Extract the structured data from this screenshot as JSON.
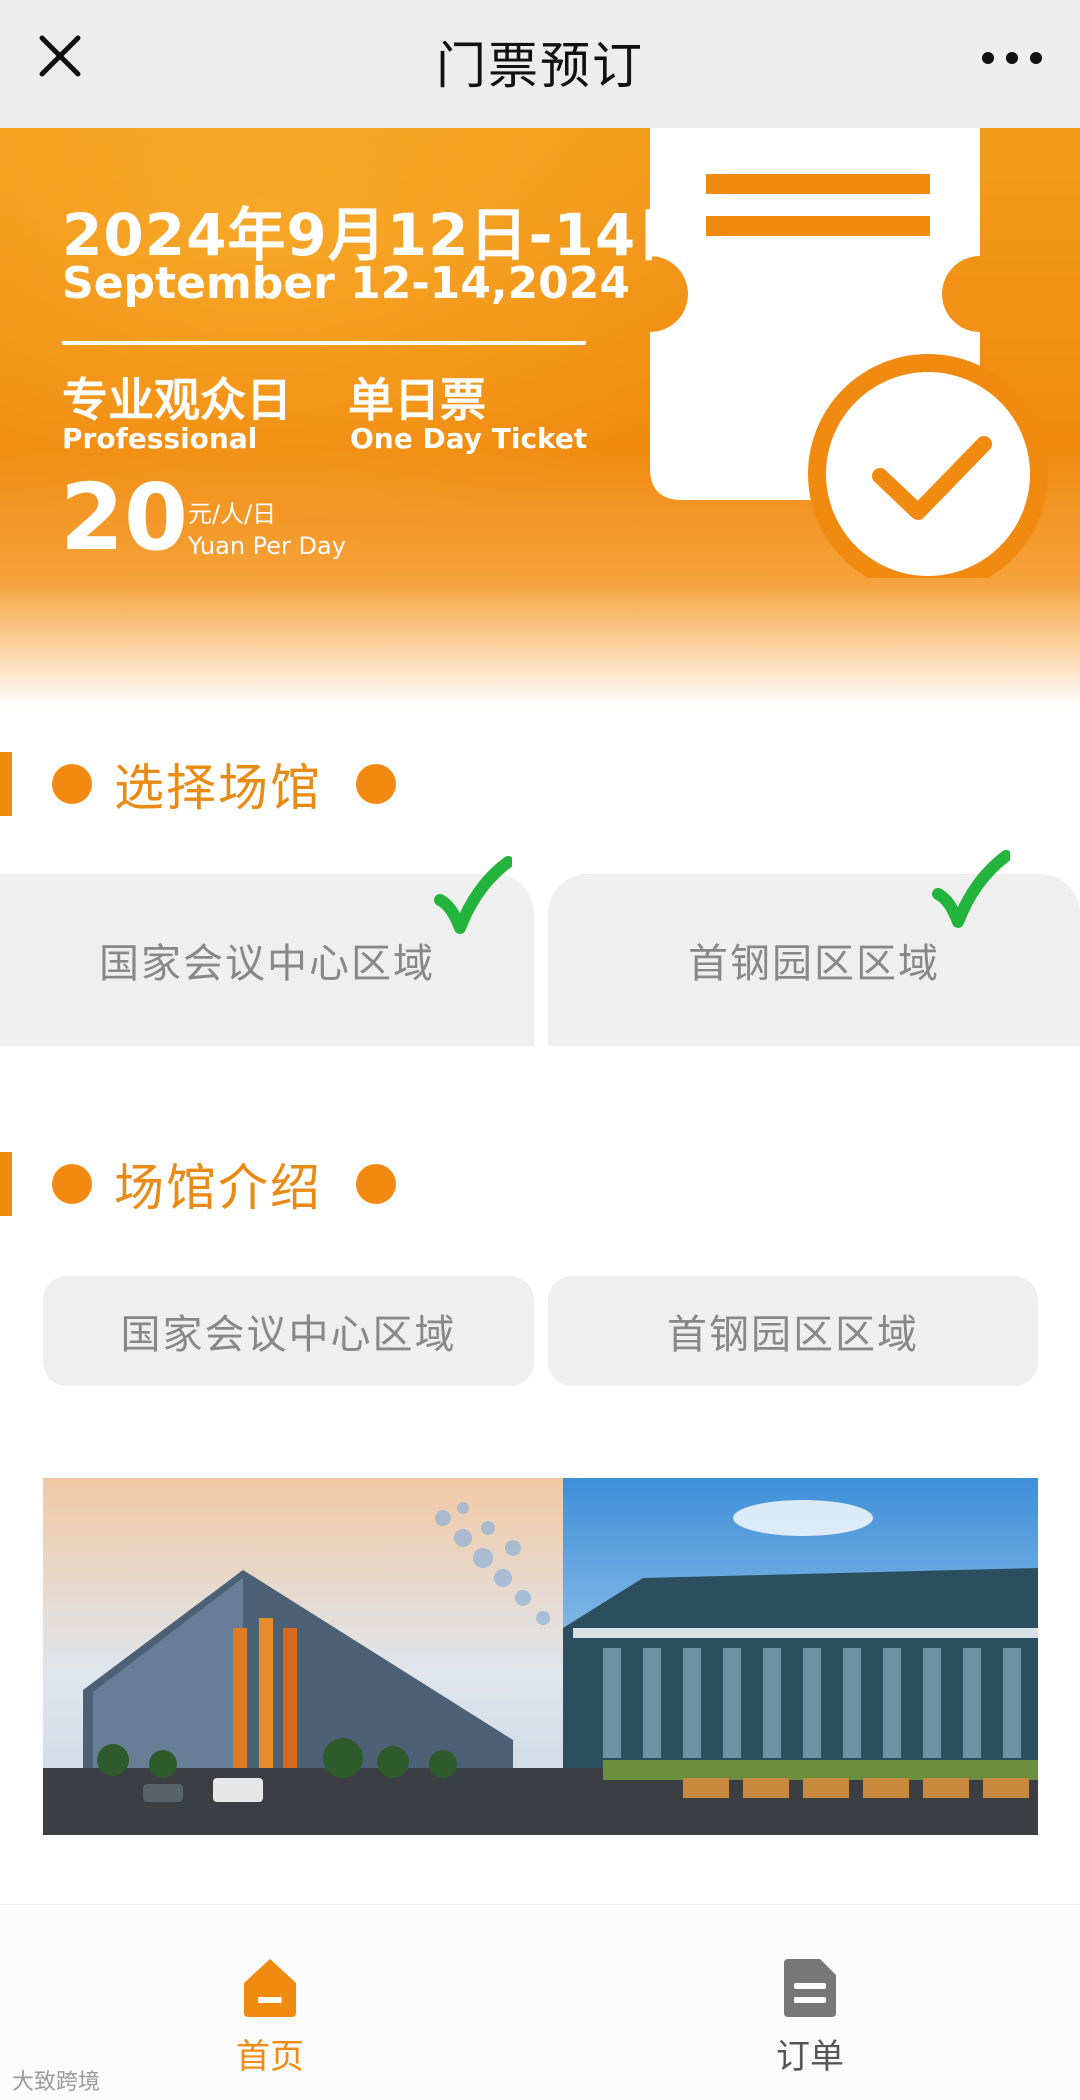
{
  "topbar": {
    "title": "门票预订",
    "close_icon": "close-icon",
    "more_icon": "more-dots-icon"
  },
  "banner": {
    "date_cn": "2024年9月12日-14日",
    "date_en": "September 12-14,2024",
    "audience_cn": "专业观众日",
    "audience_en": "Professional",
    "ticket_cn": "单日票",
    "ticket_en": "One Day Ticket",
    "price": "20",
    "unit_cn": "元/人/日",
    "unit_en": "Yuan Per Day",
    "graphic_icon": "ticket-check-icon",
    "accent_color": "#f08a10"
  },
  "select_section": {
    "title": "选择场馆",
    "venues": [
      {
        "label": "国家会议中心区域",
        "selected": true
      },
      {
        "label": "首钢园区区域",
        "selected": true
      }
    ],
    "check_color": "#22b43c"
  },
  "intro_section": {
    "title": "场馆介绍",
    "tabs": [
      {
        "label": "国家会议中心区域"
      },
      {
        "label": "首钢园区区域"
      }
    ]
  },
  "photo": {
    "icon": "venue-photo"
  },
  "bottom_nav": {
    "items": [
      {
        "label": "首页",
        "icon": "home-icon",
        "active": true,
        "color": "#f08a10"
      },
      {
        "label": "订单",
        "icon": "order-icon",
        "active": false,
        "color": "#555555"
      }
    ]
  },
  "watermark": "大致跨境"
}
